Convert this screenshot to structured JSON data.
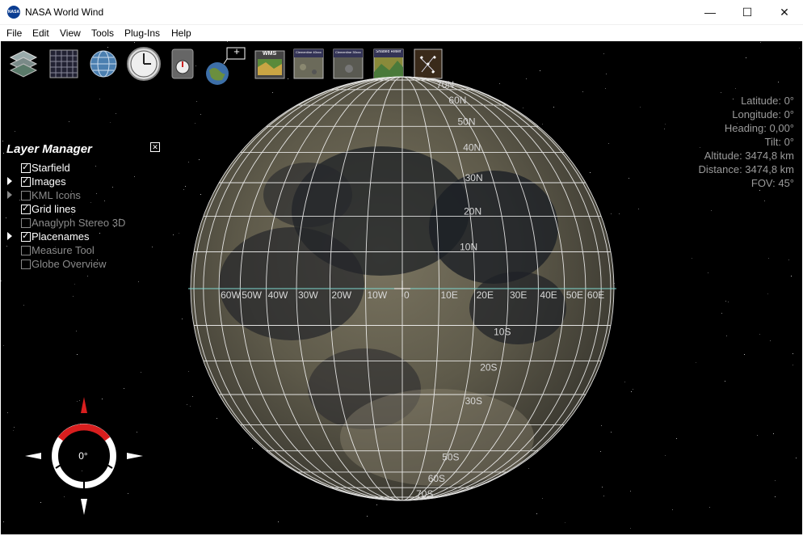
{
  "window": {
    "title": "NASA World Wind",
    "app_icon": "nasa-logo-icon",
    "controls": {
      "minimize": "—",
      "maximize": "☐",
      "close": "✕"
    }
  },
  "menu": {
    "items": [
      "File",
      "Edit",
      "View",
      "Tools",
      "Plug-Ins",
      "Help"
    ]
  },
  "toolbar": {
    "icons": [
      {
        "name": "layers-icon"
      },
      {
        "name": "grid-icon"
      },
      {
        "name": "globe-icon"
      },
      {
        "name": "clock-icon"
      },
      {
        "name": "compass-tool-icon"
      },
      {
        "name": "add-layer-icon",
        "label": "+"
      },
      {
        "name": "wms-icon",
        "label": "WMS"
      },
      {
        "name": "moon-layer-1-icon",
        "label": "Clementine 40xxx"
      },
      {
        "name": "moon-layer-2-icon",
        "label": "Clementine 30xxx"
      },
      {
        "name": "shaded-relief-icon",
        "label": "Shaded Relief"
      },
      {
        "name": "stars-icon"
      }
    ]
  },
  "layer_manager": {
    "title": "Layer Manager",
    "close_glyph": "✕",
    "layers": [
      {
        "label": "Starfield",
        "checked": true,
        "enabled": true,
        "expandable": false
      },
      {
        "label": "Images",
        "checked": true,
        "enabled": true,
        "expandable": true
      },
      {
        "label": "KML Icons",
        "checked": false,
        "enabled": false,
        "expandable": true
      },
      {
        "label": "Grid lines",
        "checked": true,
        "enabled": true,
        "expandable": false
      },
      {
        "label": "Anaglyph Stereo 3D",
        "checked": false,
        "enabled": false,
        "expandable": false
      },
      {
        "label": "Placenames",
        "checked": true,
        "enabled": true,
        "expandable": true
      },
      {
        "label": "Measure Tool",
        "checked": false,
        "enabled": false,
        "expandable": false
      },
      {
        "label": "Globe Overview",
        "checked": false,
        "enabled": false,
        "expandable": false
      }
    ]
  },
  "position_info": {
    "latitude": "Latitude: 0°",
    "longitude": "Longitude: 0°",
    "heading": "Heading: 0,00°",
    "tilt": "Tilt: 0°",
    "altitude": "Altitude: 3474,8 km",
    "distance": "Distance: 3474,8 km",
    "fov": "FOV: 45°"
  },
  "globe": {
    "north_labels": [
      "70N",
      "60N",
      "50N",
      "40N",
      "30N",
      "20N",
      "10N"
    ],
    "south_labels": [
      "10S",
      "20S",
      "30S",
      "50S",
      "60S",
      "70S"
    ],
    "west_labels": [
      "60W",
      "50W",
      "40W",
      "30W",
      "20W",
      "10W"
    ],
    "center_label": "0",
    "east_labels": [
      "10E",
      "20E",
      "30E",
      "40E",
      "50E",
      "60E"
    ]
  },
  "compass": {
    "heading": "0°"
  },
  "colors": {
    "space": "#000000",
    "grid": "#ffffff",
    "compass_red": "#d81e1e"
  }
}
